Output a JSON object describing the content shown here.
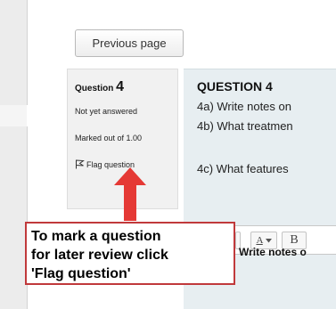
{
  "nav": {
    "previous_label": "Previous page"
  },
  "question_info": {
    "prefix": "Question",
    "number": "4",
    "status": "Not yet answered",
    "marks": "Marked out of 1.00",
    "flag_label": "Flag question"
  },
  "question": {
    "title": "QUESTION 4",
    "lines": [
      "4a)  Write notes on",
      "4b)  What treatmen",
      "4c)   What features"
    ]
  },
  "editor": {
    "toolbar": {
      "font_label": "A",
      "bold_label": "B"
    },
    "text": "Write notes o"
  },
  "callout": {
    "lines": [
      "To mark a question",
      "for later review click",
      "'Flag question'"
    ],
    "color": "#e53935",
    "border_color": "#c0393b"
  },
  "icons": {
    "flag": "flag-icon",
    "arrow": "arrow-up-icon",
    "dropdown": "chevron-down-icon"
  }
}
